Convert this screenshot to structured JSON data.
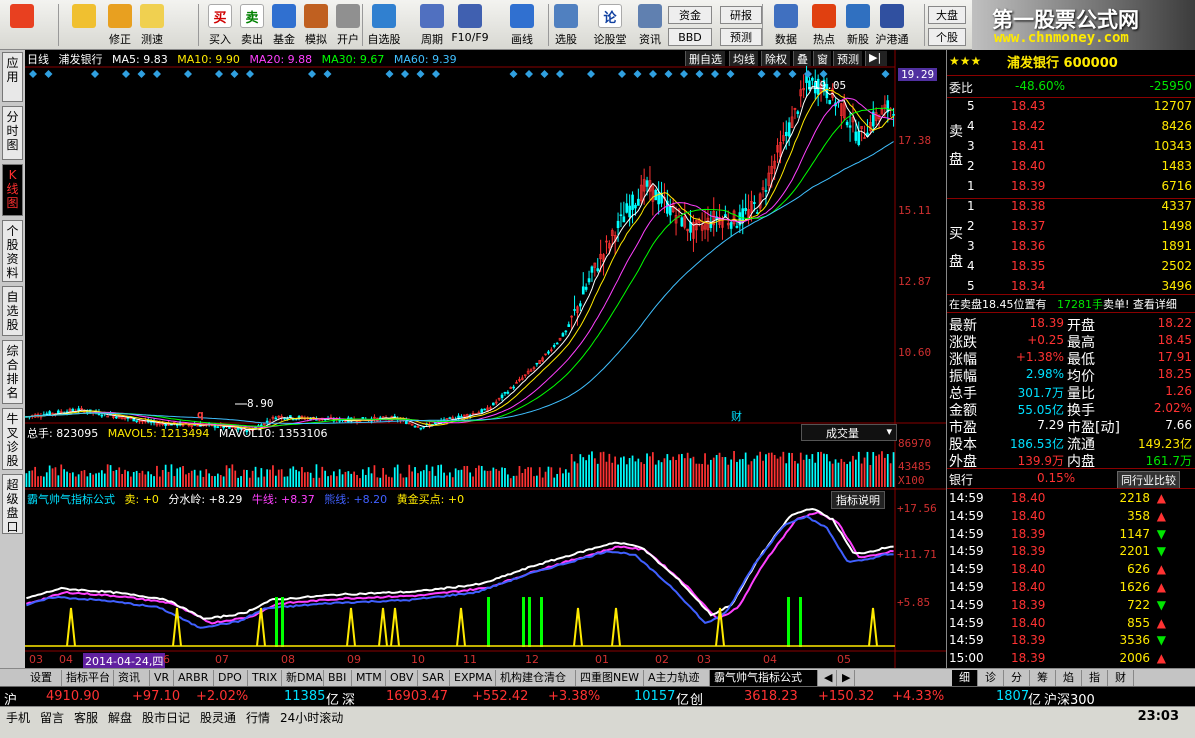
{
  "toolbar": {
    "buttons": [
      {
        "label": "",
        "icon": "windows-logo-icon"
      },
      {
        "label": "",
        "icon": "back-arrow-icon"
      },
      {
        "label": "修正",
        "icon": "up-down-arrow-icon"
      },
      {
        "label": "测速",
        "icon": "clock-icon"
      },
      {
        "label": "买入",
        "icon": "buy-icon",
        "glyph": "买"
      },
      {
        "label": "卖出",
        "icon": "sell-icon",
        "glyph": "卖"
      },
      {
        "label": "基金",
        "icon": "fund-icon"
      },
      {
        "label": "模拟",
        "icon": "hammer-icon"
      },
      {
        "label": "开户",
        "icon": "lock-icon"
      },
      {
        "label": "自选股",
        "icon": "star-list-icon"
      },
      {
        "label": "周期",
        "icon": "period-icon"
      },
      {
        "label": "F10/F9",
        "icon": "f10-icon"
      },
      {
        "label": "画线",
        "icon": "pen-icon"
      },
      {
        "label": "选股",
        "icon": "screen-icon"
      },
      {
        "label": "论股堂",
        "icon": "discuss-icon",
        "glyph": "论"
      },
      {
        "label": "资讯",
        "icon": "news-icon"
      },
      {
        "label": "数据",
        "icon": "data-icon"
      },
      {
        "label": "热点",
        "icon": "flame-icon"
      },
      {
        "label": "新股",
        "icon": "new-stock-icon"
      },
      {
        "label": "沪港通",
        "icon": "hk-icon"
      }
    ],
    "small_buttons": [
      "资金",
      "BBD",
      "研报",
      "预测",
      "大盘",
      "个股"
    ],
    "brand_title": "第一股票公式网",
    "brand_url": "www.chnmoney.com"
  },
  "left_tabs": [
    "应用",
    "分时图",
    "K线图",
    "个股资料",
    "自选股",
    "综合排名",
    "牛叉诊股",
    "超级盘口"
  ],
  "main_legend": {
    "period": "日线",
    "name": "浦发银行",
    "ma5": "MA5: 9.83",
    "ma10": "MA10: 9.90",
    "ma20": "MA20: 9.88",
    "ma30": "MA30: 9.67",
    "ma60": "MA60: 9.39",
    "buttons": [
      "删自选",
      "均线",
      "除权",
      "叠",
      "窗",
      "预测"
    ]
  },
  "price_axis": [
    "19.29",
    "17.38",
    "15.11",
    "12.87",
    "10.60"
  ],
  "price_current": "19.29",
  "annotations": {
    "high": "19.05",
    "low": "8.90",
    "q_mark": "q",
    "cai_mark": "财"
  },
  "volume_legend": {
    "total": "总手: 823095",
    "mavol5": "MAVOL5: 1213494",
    "mavol10": "MAVOL10: 1353106",
    "selector": "成交量"
  },
  "volume_axis": [
    "86970",
    "43485",
    "X100"
  ],
  "indicator_legend": {
    "name": "霸气帅气指标公式",
    "sell": "卖: +0",
    "fenshuiling": "分水岭: +8.29",
    "niuxian": "牛线: +8.37",
    "xiongxian": "熊线: +8.20",
    "huangjin": "黄金买点: +0",
    "explain": "指标说明"
  },
  "indicator_axis": [
    "+17.56",
    "+11.71",
    "+5.85"
  ],
  "dates": [
    "03",
    "04",
    "2014-04-24,四",
    "6",
    "07",
    "08",
    "09",
    "10",
    "11",
    "12",
    "01",
    "02",
    "03",
    "04",
    "05"
  ],
  "quote": {
    "title": "浦发银行 600000",
    "weibi_label": "委比",
    "weibi_pct": "-48.60%",
    "weibi_val": "-25950",
    "sell_side_label": "卖盘",
    "buy_side_label": "买盘",
    "asks": [
      {
        "n": "5",
        "price": "18.43",
        "vol": "12707"
      },
      {
        "n": "4",
        "price": "18.42",
        "vol": "8426"
      },
      {
        "n": "3",
        "price": "18.41",
        "vol": "10343"
      },
      {
        "n": "2",
        "price": "18.40",
        "vol": "1483"
      },
      {
        "n": "1",
        "price": "18.39",
        "vol": "6716"
      }
    ],
    "bids": [
      {
        "n": "1",
        "price": "18.38",
        "vol": "4337"
      },
      {
        "n": "2",
        "price": "18.37",
        "vol": "1498"
      },
      {
        "n": "3",
        "price": "18.36",
        "vol": "1891"
      },
      {
        "n": "4",
        "price": "18.35",
        "vol": "2502"
      },
      {
        "n": "5",
        "price": "18.34",
        "vol": "3496"
      }
    ],
    "notice_pre": "在卖盘18.45位置有",
    "notice_vol": "17281手",
    "notice_post": "卖单! 查看详细",
    "stats": [
      {
        "l1": "最新",
        "v1": "18.39",
        "l2": "开盘",
        "v2": "18.22"
      },
      {
        "l1": "涨跌",
        "v1": "+0.25",
        "l2": "最高",
        "v2": "18.45"
      },
      {
        "l1": "涨幅",
        "v1": "+1.38%",
        "l2": "最低",
        "v2": "17.91"
      },
      {
        "l1": "振幅",
        "v1": "2.98%",
        "l2": "均价",
        "v2": "18.25"
      },
      {
        "l1": "总手",
        "v1": "301.7万",
        "l2": "量比",
        "v2": "1.26"
      },
      {
        "l1": "金额",
        "v1": "55.05亿",
        "l2": "换手",
        "v2": "2.02%"
      },
      {
        "l1": "市盈",
        "v1": "7.29",
        "l2": "市盈[动]",
        "v2": "7.66"
      },
      {
        "l1": "股本",
        "v1": "186.53亿",
        "l2": "流通",
        "v2": "149.23亿"
      },
      {
        "l1": "外盘",
        "v1": "139.9万",
        "l2": "内盘",
        "v2": "161.7万"
      }
    ],
    "industry_name": "银行",
    "industry_pct": "0.15%",
    "industry_btn": "同行业比较",
    "ticks": [
      {
        "t": "14:59",
        "p": "18.40",
        "v": "2218",
        "d": "up"
      },
      {
        "t": "14:59",
        "p": "18.40",
        "v": "358",
        "d": "up"
      },
      {
        "t": "14:59",
        "p": "18.39",
        "v": "1147",
        "d": "down"
      },
      {
        "t": "14:59",
        "p": "18.39",
        "v": "2201",
        "d": "down"
      },
      {
        "t": "14:59",
        "p": "18.40",
        "v": "626",
        "d": "up"
      },
      {
        "t": "14:59",
        "p": "18.40",
        "v": "1626",
        "d": "up"
      },
      {
        "t": "14:59",
        "p": "18.39",
        "v": "722",
        "d": "down"
      },
      {
        "t": "14:59",
        "p": "18.40",
        "v": "855",
        "d": "up"
      },
      {
        "t": "14:59",
        "p": "18.39",
        "v": "3536",
        "d": "down"
      },
      {
        "t": "15:00",
        "p": "18.39",
        "v": "2006",
        "d": "up"
      }
    ]
  },
  "bottom_tabs": [
    "设置",
    "指标平台",
    "资讯",
    "VR",
    "ARBR",
    "DPO",
    "TRIX",
    "新DMA",
    "BBI",
    "MTM",
    "OBV",
    "SAR",
    "EXPMA",
    "机构建仓清仓",
    "四重图NEW",
    "A主力轨迹",
    "霸气帅气指标公式"
  ],
  "right_tabs": [
    "细",
    "诊",
    "分",
    "筹",
    "焰",
    "指",
    "财"
  ],
  "index_bar": {
    "sh_label": "沪",
    "sh_val": "4910.90",
    "sh_chg": "+97.10",
    "sh_pct": "+2.02%",
    "sh_amt": "11385",
    "sh_unit": "亿",
    "sz_label": "深",
    "sz_val": "16903.47",
    "sz_chg": "+552.42",
    "sz_pct": "+3.38%",
    "sz_amt": "10157",
    "sz_unit": "亿",
    "cy_label": "创",
    "cy_val": "3618.23",
    "cy_chg": "+150.32",
    "cy_pct": "+4.33%",
    "cy_amt": "1807",
    "cy_unit": "亿",
    "hs_label": "沪深300"
  },
  "status_bar": {
    "items": [
      "手机",
      "留言",
      "客服",
      "解盘",
      "股市日记",
      "股灵通",
      "行情",
      "24小时滚动"
    ],
    "time": "23:03"
  },
  "colors": {
    "up": "#ff3232",
    "down": "#00e600",
    "ma5": "#ffffff",
    "ma10": "#ffea00",
    "ma20": "#ff40ff",
    "ma30": "#00ff00",
    "ma60": "#40c0ff"
  }
}
